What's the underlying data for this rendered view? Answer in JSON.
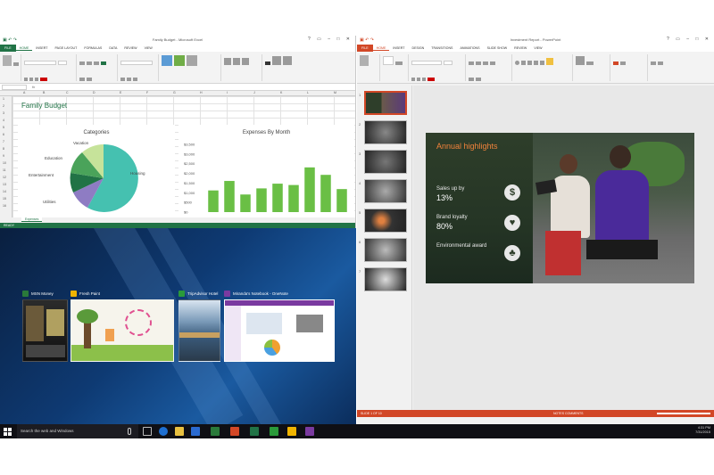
{
  "excel": {
    "window_title": "Family Budget - Microsoft Excel",
    "tabs": [
      "FILE",
      "HOME",
      "INSERT",
      "PAGE LAYOUT",
      "FORMULAS",
      "DATA",
      "REVIEW",
      "VIEW"
    ],
    "sheet_title": "Family Budget",
    "pie_title": "Categories",
    "pie_labels": [
      "Vacation",
      "Education",
      "Entertainment",
      "Utilities",
      "Housing"
    ],
    "bar_title": "Expenses By Month",
    "bar_ylabels": [
      "$3,500",
      "$3,000",
      "$2,500",
      "$2,000",
      "$1,500",
      "$1,000",
      "$500",
      "$0"
    ],
    "bar_values": [
      32,
      46,
      26,
      35,
      42,
      40,
      66,
      55,
      34
    ],
    "sheet_tab": "Expenses",
    "status": "READY",
    "accent": "#217346"
  },
  "desktop": {
    "windows": [
      {
        "title": "MSN Money",
        "color": "#2a7a3a"
      },
      {
        "title": "Fresh Paint",
        "color": "#f0b400"
      },
      {
        "title": "TripAdvisor Hotel",
        "color": "#2a9a3a"
      },
      {
        "title": "Miranda's Notebook - OneNote",
        "color": "#7a3aa0"
      }
    ]
  },
  "powerpoint": {
    "window_title": "Investment Report - PowerPoint",
    "tabs": [
      "FILE",
      "HOME",
      "INSERT",
      "DESIGN",
      "TRANSITIONS",
      "ANIMATIONS",
      "SLIDE SHOW",
      "REVIEW",
      "VIEW"
    ],
    "slide": {
      "title": "Annual highlights",
      "items": [
        {
          "label": "Sales up by",
          "value": "13%",
          "icon": "$"
        },
        {
          "label": "Brand loyalty",
          "value": "80%",
          "icon": "♥"
        },
        {
          "label": "Environmental award",
          "value": "",
          "icon": "♣"
        }
      ]
    },
    "status_left": "SLIDE 1 OF 10",
    "status_right": "NOTES   COMMENTS",
    "accent": "#d24726"
  },
  "taskbar": {
    "search_placeholder": "Search the web and Windows",
    "time": "4:31 PM",
    "date": "7/31/2015"
  }
}
